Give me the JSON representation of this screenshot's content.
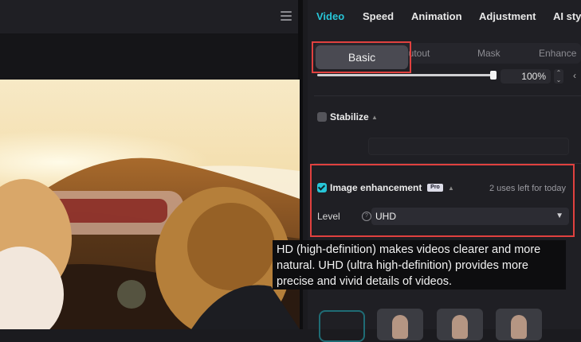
{
  "tabs": [
    {
      "label": "Video",
      "active": true
    },
    {
      "label": "Speed",
      "active": false
    },
    {
      "label": "Animation",
      "active": false
    },
    {
      "label": "Adjustment",
      "active": false
    },
    {
      "label": "AI sty",
      "active": false
    }
  ],
  "subtabs": {
    "basic": "Basic",
    "cutout": "Cutout",
    "mask": "Mask",
    "enhance": "Enhance"
  },
  "scale": {
    "value_label": "100%",
    "level": 1.0
  },
  "stabilize": {
    "label": "Stabilize",
    "checked": false
  },
  "image_enhancement": {
    "label": "Image enhancement",
    "badge": "Pro",
    "checked": true,
    "uses_left": "2 uses left for today",
    "level_label": "Level",
    "level_value": "UHD"
  },
  "tooltip": {
    "text": "HD (high-definition) makes videos clearer and more natural. UHD (ultra high-definition) provides more precise and vivid details of videos."
  },
  "icons": [
    "menu-icon",
    "stepper-icon",
    "reset-icon",
    "info-icon",
    "chevron-down-icon",
    "caret-up-icon"
  ],
  "colors": {
    "accent": "#27c6d8",
    "highlight_box": "#e0413f",
    "panel_bg": "#1f1f24"
  }
}
